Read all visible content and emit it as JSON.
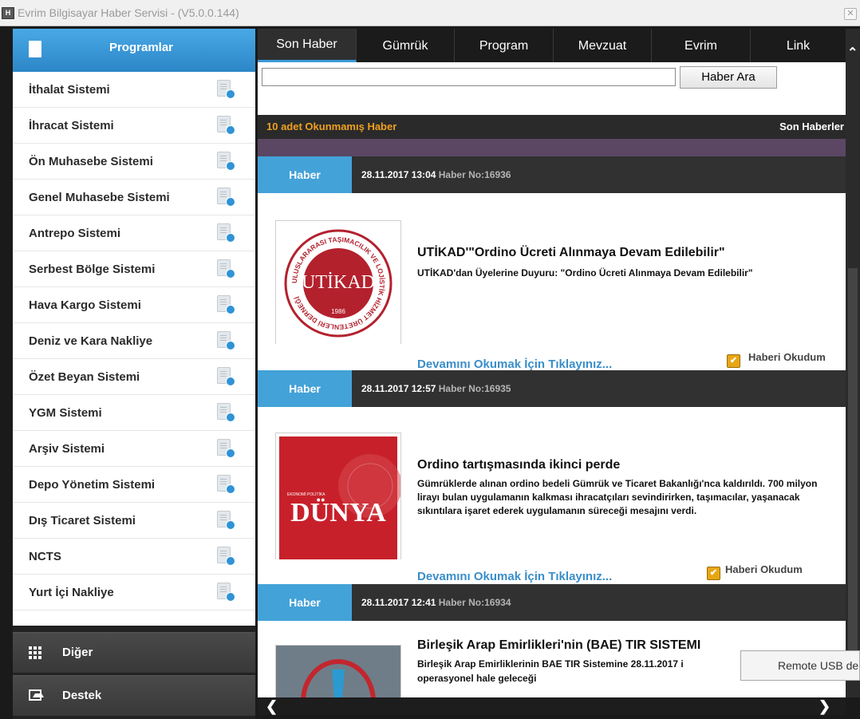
{
  "window": {
    "title": "Evrim Bilgisayar Haber Servisi - (V5.0.0.144)",
    "app_icon": "H"
  },
  "sidebar": {
    "header_label": "Programlar",
    "items": [
      {
        "label": "İthalat Sistemi"
      },
      {
        "label": "İhracat Sistemi"
      },
      {
        "label": "Ön Muhasebe Sistemi"
      },
      {
        "label": "Genel Muhasebe Sistemi"
      },
      {
        "label": "Antrepo Sistemi"
      },
      {
        "label": "Serbest Bölge Sistemi"
      },
      {
        "label": "Hava Kargo Sistemi"
      },
      {
        "label": "Deniz ve Kara Nakliye"
      },
      {
        "label": "Özet Beyan Sistemi"
      },
      {
        "label": "YGM Sistemi"
      },
      {
        "label": "Arşiv Sistemi"
      },
      {
        "label": "Depo Yönetim Sistemi"
      },
      {
        "label": "Dış Ticaret Sistemi"
      },
      {
        "label": "NCTS"
      },
      {
        "label": "Yurt İçi Nakliye"
      }
    ],
    "other_label": "Diğer",
    "support_label": "Destek"
  },
  "tabs": [
    {
      "label": "Son Haber",
      "active": true
    },
    {
      "label": "Gümrük"
    },
    {
      "label": "Program"
    },
    {
      "label": "Mevzuat"
    },
    {
      "label": "Evrim"
    },
    {
      "label": "Link"
    }
  ],
  "search": {
    "value": "",
    "button": "Haber Ara"
  },
  "status": {
    "unread": "10 adet Okunmamış Haber",
    "section": "Son Haberler"
  },
  "news": [
    {
      "badge": "Haber",
      "date": "28.11.2017 13:04",
      "no": "Haber No:16936",
      "title": "UTİKAD'\"Ordino Ücreti Alınmaya Devam Edilebilir\"",
      "summary": "UTİKAD'dan Üyelerine Duyuru: \"Ordino Ücreti Alınmaya Devam Edilebilir\"",
      "more": "Devamını Okumak İçin Tıklayınız...",
      "read_label": "Haberi Okudum",
      "logo_text": "UTİKAD",
      "logo_year": "1986",
      "logo_ring": "ULUSLARARASI TAŞIMACILIK VE LOJİSTİK HİZMET ÜRETENLERİ DERNEĞİ"
    },
    {
      "badge": "Haber",
      "date": "28.11.2017 12:57",
      "no": "Haber No:16935",
      "title": "Ordino tartışmasında ikinci perde",
      "summary": "Gümrüklerde alınan ordino bedeli Gümrük ve Ticaret Bakanlığı'nca kaldırıldı. 700 milyon lirayı bulan uygulamanın kalkması ihracatçıları sevindirirken, taşımacılar, yaşanacak sıkıntılara işaret ederek uygulamanın süreceği mesajını verdi.",
      "more": "Devamını Okumak İçin Tıklayınız...",
      "read_label": "Haberi Okudum",
      "logo_text": "DÜNYA",
      "logo_sub": "EKONOMİ POLİTİKA"
    },
    {
      "badge": "Haber",
      "date": "28.11.2017 12:41",
      "no": "Haber No:16934",
      "title": "Birleşik Arap Emirlikleri'nin (BAE) TIR SISTEMI",
      "summary": "Birleşik Arap Emirliklerinin BAE TIR Sistemine 28.11.2017 i",
      "summary2": "operasyonel hale geleceği"
    }
  ],
  "tooltip": {
    "text": "Remote USB de"
  },
  "colors": {
    "accent": "#3a9bd9",
    "unread": "#f0a020",
    "checkbox": "#e7a614",
    "dunya_red": "#c8202a",
    "utikad_red": "#b3212d"
  }
}
